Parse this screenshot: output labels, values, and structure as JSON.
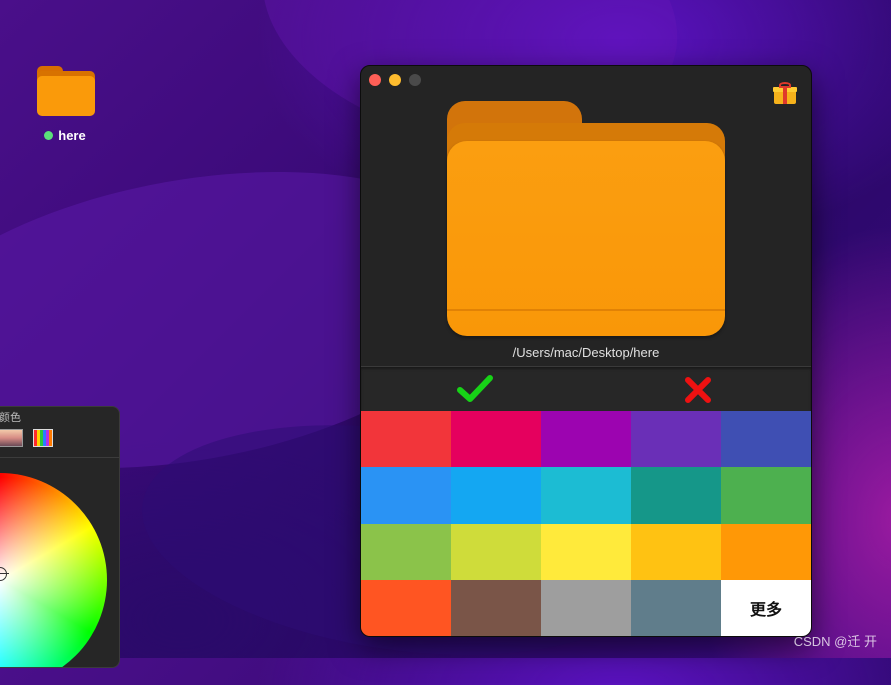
{
  "desktop": {
    "folder_label": "here",
    "folder_color": "#fa9a0a",
    "tag_color": "#5be07a"
  },
  "color_panel": {
    "title": "颜色"
  },
  "window": {
    "path": "/Users/mac/Desktop/here",
    "confirm_icon": "checkmark-icon",
    "cancel_icon": "x-icon",
    "gift_icon": "gift-icon"
  },
  "swatches": [
    {
      "color": "#f2353a",
      "label": ""
    },
    {
      "color": "#e5005e",
      "label": ""
    },
    {
      "color": "#9c04b0",
      "label": ""
    },
    {
      "color": "#6a2fb7",
      "label": ""
    },
    {
      "color": "#3f4fb3",
      "label": ""
    },
    {
      "color": "#2a93f4",
      "label": ""
    },
    {
      "color": "#14a7f2",
      "label": ""
    },
    {
      "color": "#1cbcd3",
      "label": ""
    },
    {
      "color": "#159789",
      "label": ""
    },
    {
      "color": "#4db04f",
      "label": ""
    },
    {
      "color": "#8bc34a",
      "label": ""
    },
    {
      "color": "#cfdc3a",
      "label": ""
    },
    {
      "color": "#ffea3b",
      "label": ""
    },
    {
      "color": "#ffc212",
      "label": ""
    },
    {
      "color": "#ff9806",
      "label": ""
    },
    {
      "color": "#ff5522",
      "label": ""
    },
    {
      "color": "#7a5548",
      "label": ""
    },
    {
      "color": "#9e9e9e",
      "label": ""
    },
    {
      "color": "#607d8b",
      "label": ""
    },
    {
      "color": "#ffffff",
      "label": "更多"
    }
  ],
  "watermark": "CSDN @迁 开"
}
